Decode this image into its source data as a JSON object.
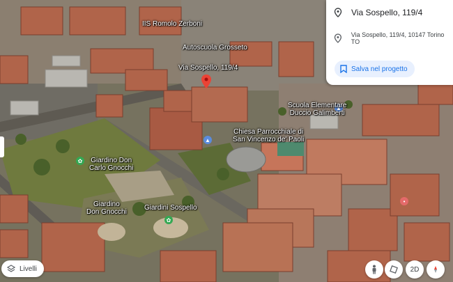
{
  "place_panel": {
    "title": "Via Sospello, 119/4",
    "address": "Via Sospello, 119/4, 10147 Torino TO",
    "save_label": "Salva nel progetto"
  },
  "map_labels": {
    "iis": "IIS Romolo Zerboni",
    "autoscuola": "Autoscuola Grosseto",
    "via_sospello": "Via Sospello, 119/4",
    "scuola_1": "Scuola Elementare",
    "scuola_2": "Duccio Galimberti",
    "chiesa_1": "Chiesa Parrocchiale di",
    "chiesa_2": "San Vincenzo de' Paoli",
    "giardino_cg_1": "Giardino Don",
    "giardino_cg_2": "Carlo Gnocchi",
    "giardino_dg_1": "Giardino",
    "giardino_dg_2": "Don Gnocchi",
    "giardini_sospello": "Giardini Sospello"
  },
  "controls": {
    "layers_label": "Livelli",
    "view_2d_label": "2D"
  },
  "colors": {
    "pin_red": "#ea4335",
    "park_green": "#34a853",
    "accent_blue": "#1a73e8"
  }
}
